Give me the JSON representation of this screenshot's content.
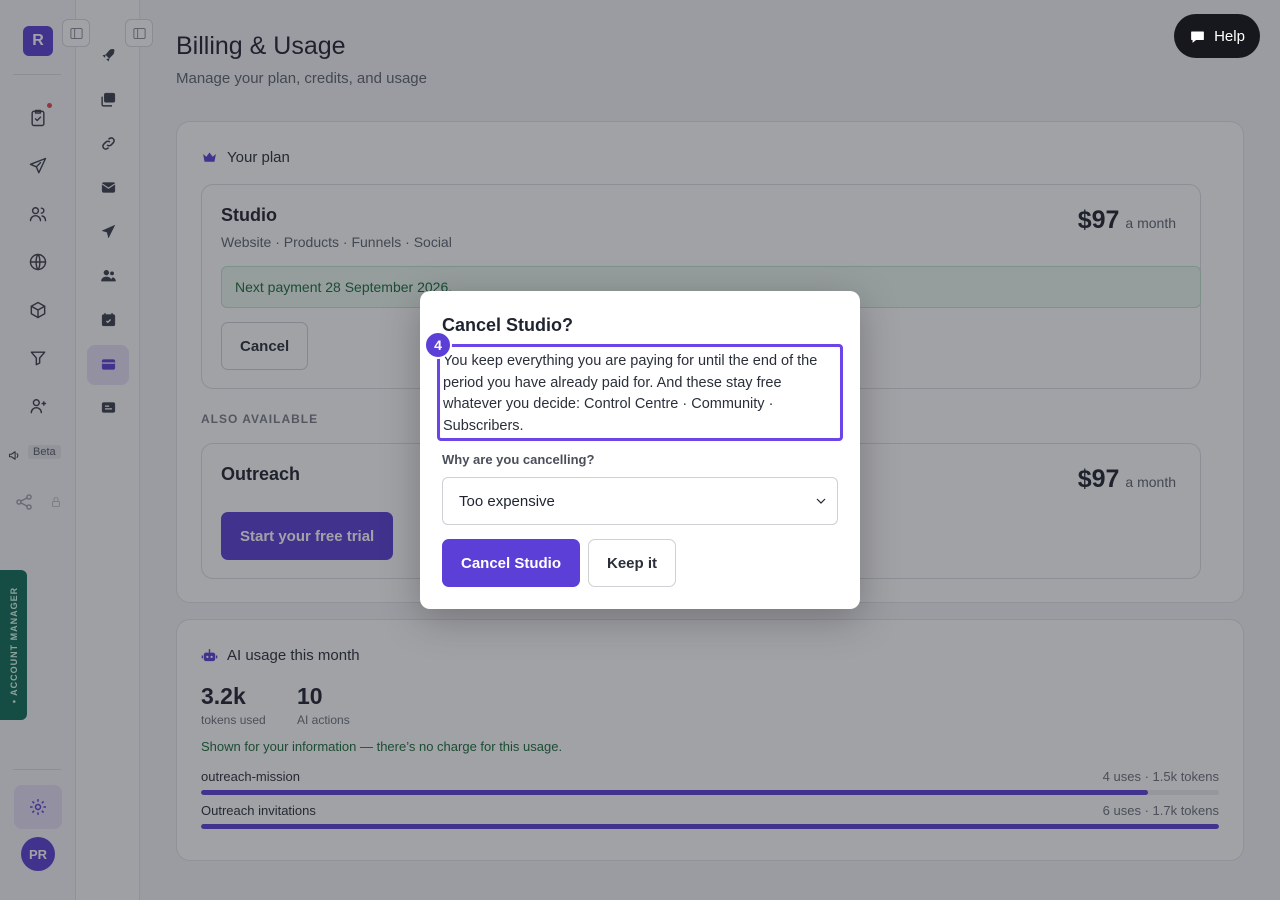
{
  "rail": {
    "logo_letter": "R",
    "beta_label": "Beta",
    "avatar_initials": "PR",
    "account_manager_label": "• ACCOUNT MANAGER"
  },
  "page": {
    "title": "Billing & Usage",
    "subtitle": "Manage your plan, credits, and usage"
  },
  "help": {
    "label": "Help"
  },
  "plan": {
    "heading": "Your plan",
    "current": {
      "name": "Studio",
      "features": "Website · Products · Funnels · Social",
      "price": "$97",
      "period": "a month",
      "next_payment": "Next payment 28 September 2026.",
      "cancel_label": "Cancel"
    },
    "also_available_label": "ALSO AVAILABLE",
    "other": {
      "name": "Outreach",
      "price": "$97",
      "period": "a month",
      "trial_label": "Start your free trial"
    }
  },
  "usage": {
    "heading": "AI usage this month",
    "stats": [
      {
        "value": "3.2k",
        "label": "tokens used"
      },
      {
        "value": "10",
        "label": "AI actions"
      }
    ],
    "note": "Shown for your information — there’s no charge for this usage.",
    "rows": [
      {
        "name": "outreach-mission",
        "meta": "4 uses · 1.5k tokens",
        "fraction": 0.93
      },
      {
        "name": "Outreach invitations",
        "meta": "6 uses · 1.7k tokens",
        "fraction": 1.0
      }
    ]
  },
  "modal": {
    "title": "Cancel Studio?",
    "step_number": "4",
    "body": "You keep everything you are paying for until the end of the period you have already paid for. And these stay free whatever you decide: Control Centre · Community · Subscribers.",
    "reason_label": "Why are you cancelling?",
    "reason_value": "Too expensive",
    "confirm_label": "Cancel Studio",
    "keep_label": "Keep it"
  },
  "colors": {
    "accent": "#5b3fd6",
    "success_text": "#1b6b3a",
    "account_tab": "#0f6b55"
  }
}
